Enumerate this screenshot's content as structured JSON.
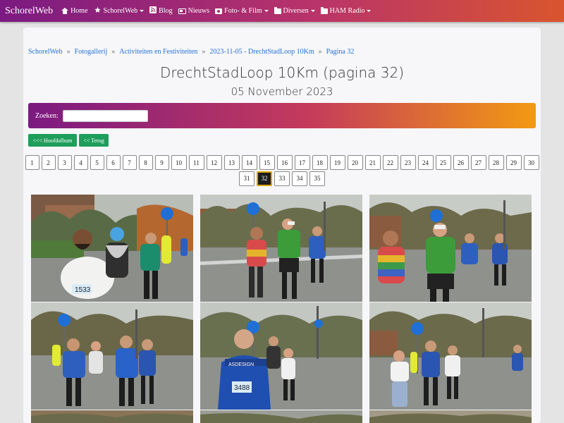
{
  "navbar": {
    "brand": "SchorelWeb",
    "items": [
      {
        "label": "Home",
        "icon": "house-icon",
        "dropdown": false
      },
      {
        "label": "SchorelWeb",
        "icon": "star-icon",
        "dropdown": true
      },
      {
        "label": "Blog",
        "icon": "rss-icon",
        "dropdown": false
      },
      {
        "label": "Nieuws",
        "icon": "newspaper-icon",
        "dropdown": false
      },
      {
        "label": "Foto- & Film",
        "icon": "camera-icon",
        "dropdown": true
      },
      {
        "label": "Diversen",
        "icon": "folder-icon",
        "dropdown": true
      },
      {
        "label": "HAM Radio",
        "icon": "folder-icon",
        "dropdown": true
      }
    ],
    "colors": {
      "start": "#7b1a82",
      "mid": "#b8336a",
      "end": "#d9552e"
    }
  },
  "breadcrumb": [
    "SchorelWeb",
    "Fotogallerij",
    "Activiteiten en Festiviteiten",
    "2023-11-05 - DrechtStadLoop 10Km",
    "Pagina 32"
  ],
  "page": {
    "title": "DrechtStadLoop 10Km (pagina 32)",
    "subtitle": "05 November 2023"
  },
  "search": {
    "label": "Zoeken:",
    "value": ""
  },
  "buttons": {
    "main_album": "<<< Hoofdalbum",
    "back": "<< Terug"
  },
  "pagination": {
    "pages": [
      "1",
      "2",
      "3",
      "4",
      "5",
      "6",
      "7",
      "8",
      "9",
      "10",
      "11",
      "12",
      "13",
      "14",
      "15",
      "16",
      "17",
      "18",
      "19",
      "20",
      "21",
      "22",
      "23",
      "24",
      "25",
      "26",
      "27",
      "28",
      "29",
      "30",
      "31",
      "32",
      "33",
      "34",
      "35"
    ],
    "current": "32"
  },
  "gallery": {
    "photos": [
      {
        "bib": "1533"
      },
      {
        "bib": ""
      },
      {
        "bib": ""
      },
      {
        "bib": ""
      },
      {
        "bib": "3488"
      },
      {
        "bib": ""
      }
    ]
  }
}
